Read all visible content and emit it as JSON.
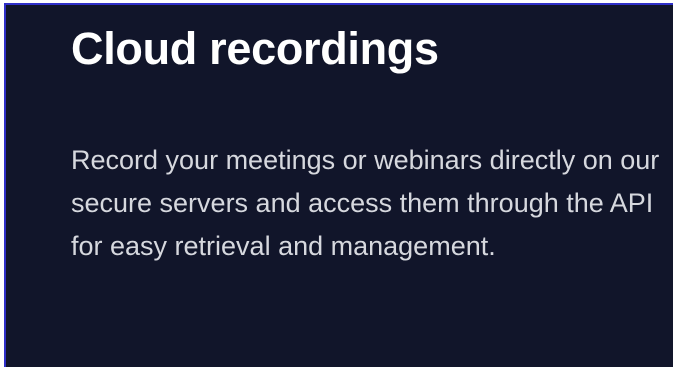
{
  "card": {
    "title": "Cloud recordings",
    "description": "Record your meetings or webinars directly on our secure servers and access them through the API for easy retrieval and management."
  },
  "colors": {
    "background": "#11152a",
    "border_accent": "#2f2fc8",
    "title_text": "#ffffff",
    "body_text": "#d6d8de"
  }
}
